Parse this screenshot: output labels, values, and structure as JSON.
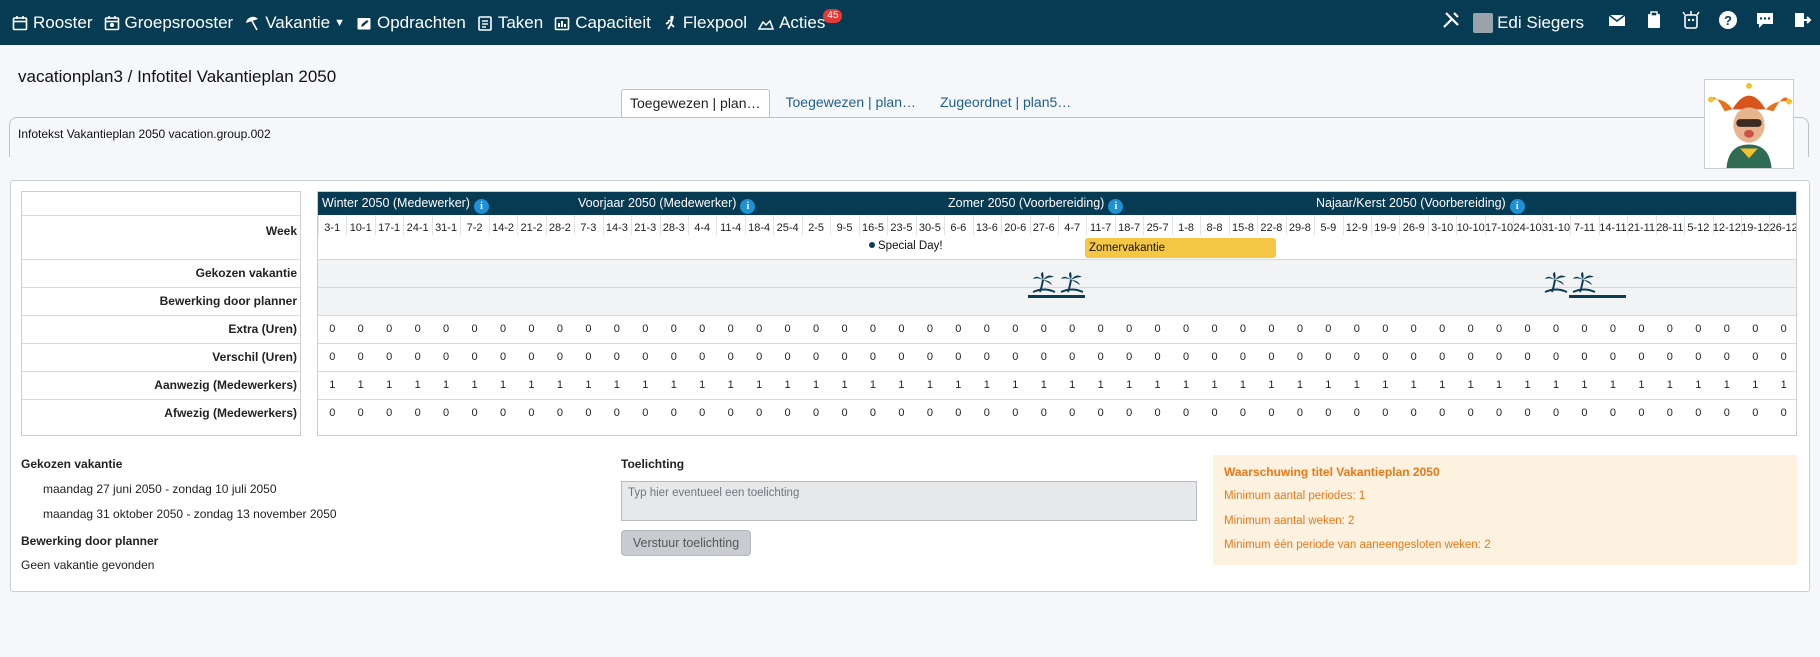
{
  "nav": {
    "items": [
      {
        "label": "Rooster",
        "icon": "calendar-icon"
      },
      {
        "label": "Groepsrooster",
        "icon": "group-calendar-icon"
      },
      {
        "label": "Vakantie",
        "icon": "umbrella-icon"
      },
      {
        "label": "Opdrachten",
        "icon": "edit-calendar-icon"
      },
      {
        "label": "Taken",
        "icon": "tasks-icon"
      },
      {
        "label": "Capaciteit",
        "icon": "capacity-icon"
      },
      {
        "label": "Flexpool",
        "icon": "runner-icon"
      },
      {
        "label": "Acties",
        "icon": "actions-icon",
        "badge": "45"
      }
    ],
    "user_name": "Edi Siegers"
  },
  "page": {
    "title": "vacationplan3 / Infotitel Vakantieplan 2050",
    "tabs": [
      "Toegewezen | plan…",
      "Toegewezen | plan…",
      "Zugeordnet | plan5…"
    ],
    "description": "Infotekst Vakantieplan 2050 vacation.group.002"
  },
  "grid": {
    "seasons": [
      "Winter 2050 (Medewerker)",
      "Voorjaar 2050 (Medewerker)",
      "Zomer 2050 (Voorbereiding)",
      "Najaar/Kerst 2050 (Voorbereiding)"
    ],
    "row_labels": {
      "week": "Week",
      "chosen": "Gekozen vakantie",
      "planner": "Bewerking door planner",
      "extra": "Extra (Uren)",
      "diff": "Verschil (Uren)",
      "present": "Aanwezig (Medewerkers)",
      "absent": "Afwezig (Medewerkers)"
    },
    "weeks": [
      "3-1",
      "10-1",
      "17-1",
      "24-1",
      "31-1",
      "7-2",
      "14-2",
      "21-2",
      "28-2",
      "7-3",
      "14-3",
      "21-3",
      "28-3",
      "4-4",
      "11-4",
      "18-4",
      "25-4",
      "2-5",
      "9-5",
      "16-5",
      "23-5",
      "30-5",
      "6-6",
      "13-6",
      "20-6",
      "27-6",
      "4-7",
      "11-7",
      "18-7",
      "25-7",
      "1-8",
      "8-8",
      "15-8",
      "22-8",
      "29-8",
      "5-9",
      "12-9",
      "19-9",
      "26-9",
      "3-10",
      "10-10",
      "17-10",
      "24-10",
      "31-10",
      "7-11",
      "14-11",
      "21-11",
      "28-11",
      "5-12",
      "12-12",
      "19-12",
      "26-12"
    ],
    "special_day": "Special Day!",
    "summer_label": "Zomervakantie",
    "extra_value": "0",
    "diff_value": "0",
    "present_value": "1",
    "absent_value": "0"
  },
  "chosen": {
    "title": "Gekozen vakantie",
    "periods": [
      "maandag 27 juni 2050 - zondag 10 juli 2050",
      "maandag 31 oktober 2050 - zondag 13 november 2050"
    ],
    "planner_title": "Bewerking door planner",
    "planner_text": "Geen vakantie gevonden"
  },
  "comment": {
    "title": "Toelichting",
    "placeholder": "Typ hier eventueel een toelichting",
    "button": "Verstuur toelichting"
  },
  "warning": {
    "title": "Waarschuwing titel Vakantieplan 2050",
    "lines": [
      "Minimum aantal periodes: 1",
      "Minimum aantal weken: 2",
      "Minimum één periode van aaneengesloten weken: 2"
    ]
  },
  "colors": {
    "nav_bg": "#073a53",
    "summer": "#f5c745",
    "warning_text": "#e57a1a",
    "warning_bg": "#fdf1df"
  }
}
